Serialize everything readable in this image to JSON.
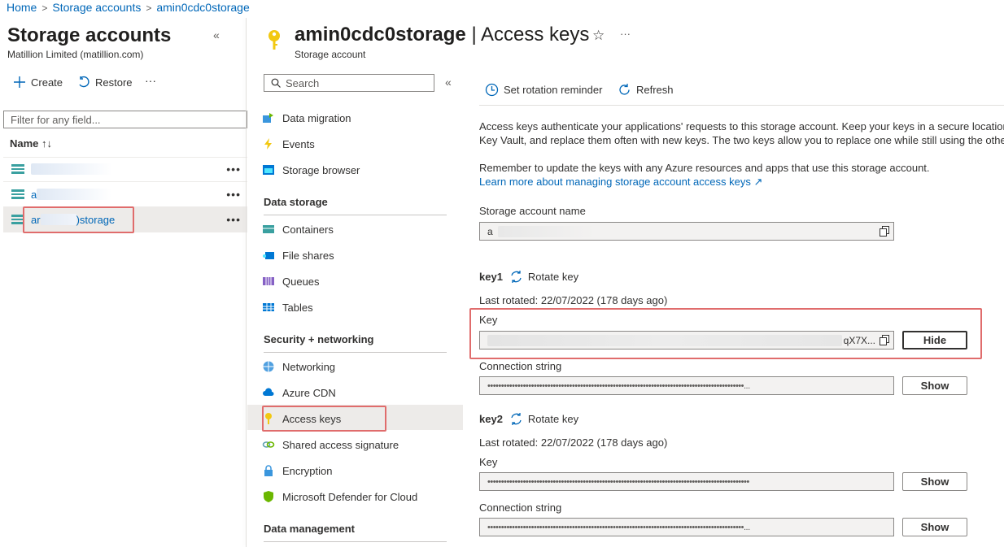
{
  "breadcrumb": {
    "items": [
      "Home",
      "Storage accounts",
      "amin0cdc0storage"
    ]
  },
  "left_panel": {
    "title": "Storage accounts",
    "subtitle": "Matillion Limited (matillion.com)",
    "toolbar": {
      "create": "Create",
      "restore": "Restore",
      "more": "···"
    },
    "filter_placeholder": "Filter for any field...",
    "column_header": "Name ↑↓",
    "rows": [
      {
        "name": ""
      },
      {
        "name": "a"
      },
      {
        "name_prefix": "ar",
        "name_suffix": ")storage"
      }
    ],
    "row_more": "•••"
  },
  "resource": {
    "name": "amin0cdc0storage",
    "page": "| Access keys",
    "type": "Storage account"
  },
  "menu": {
    "search_placeholder": "Search",
    "items_top": [
      "Data migration",
      "Events",
      "Storage browser"
    ],
    "section_data_storage": "Data storage",
    "items_data_storage": [
      "Containers",
      "File shares",
      "Queues",
      "Tables"
    ],
    "section_security": "Security + networking",
    "items_security": [
      "Networking",
      "Azure CDN",
      "Access keys",
      "Shared access signature",
      "Encryption",
      "Microsoft Defender for Cloud"
    ],
    "section_data_management": "Data management"
  },
  "command_bar": {
    "set_rotation": "Set rotation reminder",
    "refresh": "Refresh"
  },
  "description": {
    "line1": "Access keys authenticate your applications' requests to this storage account. Keep your keys in a secure location",
    "line2": "Key Vault, and replace them often with new keys. The two keys allow you to replace one while still using the othe",
    "reminder": "Remember to update the keys with any Azure resources and apps that use this storage account.",
    "learn_more": "Learn more about managing storage account access keys ↗"
  },
  "storage_account_name": {
    "label": "Storage account name",
    "value": "a"
  },
  "key1": {
    "title": "key1",
    "rotate": "Rotate key",
    "last_rotated": "Last rotated: 22/07/2022 (178 days ago)",
    "key_label": "Key",
    "key_value_tail": "qX7X...",
    "key_button": "Hide",
    "conn_label": "Connection string",
    "conn_value": "••••••••••••••••••••••••••••••••••••••••••••••••••••••••••••••••••••••••••••••••••••••••••••••...",
    "conn_button": "Show"
  },
  "key2": {
    "title": "key2",
    "rotate": "Rotate key",
    "last_rotated": "Last rotated: 22/07/2022 (178 days ago)",
    "key_label": "Key",
    "key_value": "••••••••••••••••••••••••••••••••••••••••••••••••••••••••••••••••••••••••••••••••••••••••••••••••",
    "key_button": "Show",
    "conn_label": "Connection string",
    "conn_value": "••••••••••••••••••••••••••••••••••••••••••••••••••••••••••••••••••••••••••••••••••••••••••••••...",
    "conn_button": "Show"
  },
  "colors": {
    "accent": "#0067b8",
    "highlight": "#e06c6c",
    "selected": "#edebe9"
  }
}
